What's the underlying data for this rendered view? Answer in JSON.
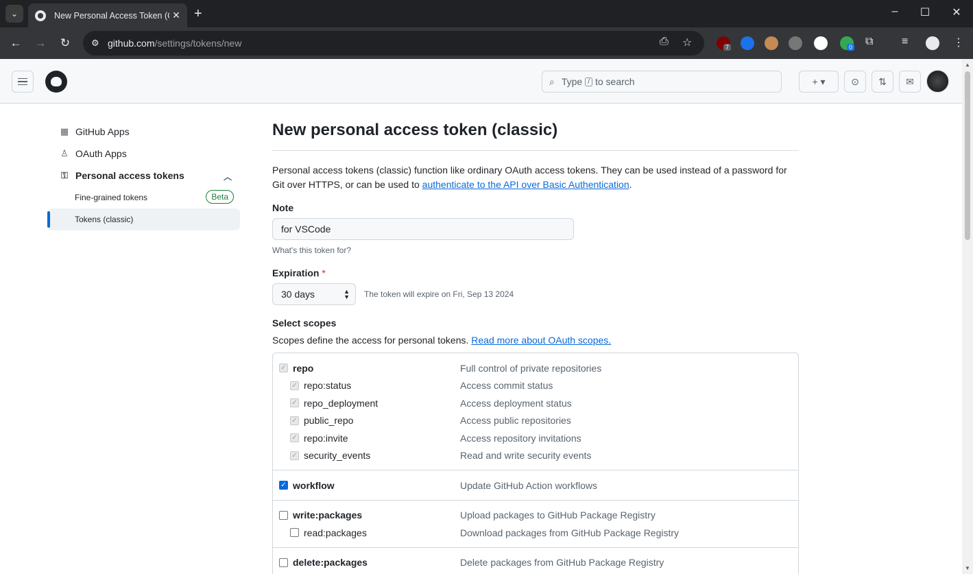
{
  "browser": {
    "tab_title": "New Personal Access Token (Cla",
    "tab_close": "✕",
    "new_tab": "+",
    "url_host": "github.com",
    "url_path": "/settings/tokens/new",
    "window_controls": [
      "–",
      "☐",
      "✕"
    ],
    "extensions": [
      {
        "name": "ublock-icon",
        "color": "#800000",
        "badge": "7"
      },
      {
        "name": "1password-icon",
        "color": "#1a73e8",
        "badge": ""
      },
      {
        "name": "owl-icon",
        "color": "#c58a55",
        "badge": ""
      },
      {
        "name": "tiger-icon",
        "color": "#777777",
        "badge": ""
      },
      {
        "name": "circle-icon",
        "color": "#ffffff",
        "badge": ""
      },
      {
        "name": "colorful-ext-icon",
        "color": "#34a853",
        "badge": "0"
      }
    ]
  },
  "header": {
    "search_prefix": "Type",
    "search_key": "/",
    "search_suffix": "to search",
    "new_button": "+ ▾"
  },
  "sidebar": {
    "items": [
      {
        "label": "GitHub Apps",
        "icon": "apps-icon"
      },
      {
        "label": "OAuth Apps",
        "icon": "person-icon"
      },
      {
        "label": "Personal access tokens",
        "icon": "key-icon"
      }
    ],
    "sub_items": [
      {
        "label": "Fine-grained tokens",
        "badge": "Beta"
      },
      {
        "label": "Tokens (classic)"
      }
    ]
  },
  "main": {
    "title": "New personal access token (classic)",
    "intro_text": "Personal access tokens (classic) function like ordinary OAuth access tokens. They can be used instead of a password for Git over HTTPS, or can be used to ",
    "intro_link": "authenticate to the API over Basic Authentication",
    "intro_end": ".",
    "note_label": "Note",
    "note_value": "for VSCode",
    "note_hint": "What's this token for?",
    "expiration_label": "Expiration",
    "expiration_required": "*",
    "expiration_value": "30 days",
    "expiration_note": "The token will expire on Fri, Sep 13 2024",
    "scopes_label": "Select scopes",
    "scopes_desc": "Scopes define the access for personal tokens. ",
    "scopes_link": "Read more about OAuth scopes."
  },
  "scopes": [
    {
      "rows": [
        {
          "name": "repo",
          "desc": "Full control of private repositories",
          "state": "disabled-checked",
          "sub": false
        },
        {
          "name": "repo:status",
          "desc": "Access commit status",
          "state": "disabled-checked",
          "sub": true
        },
        {
          "name": "repo_deployment",
          "desc": "Access deployment status",
          "state": "disabled-checked",
          "sub": true
        },
        {
          "name": "public_repo",
          "desc": "Access public repositories",
          "state": "disabled-checked",
          "sub": true
        },
        {
          "name": "repo:invite",
          "desc": "Access repository invitations",
          "state": "disabled-checked",
          "sub": true
        },
        {
          "name": "security_events",
          "desc": "Read and write security events",
          "state": "disabled-checked",
          "sub": true
        }
      ]
    },
    {
      "rows": [
        {
          "name": "workflow",
          "desc": "Update GitHub Action workflows",
          "state": "checked",
          "sub": false
        }
      ]
    },
    {
      "rows": [
        {
          "name": "write:packages",
          "desc": "Upload packages to GitHub Package Registry",
          "state": "unchecked",
          "sub": false
        },
        {
          "name": "read:packages",
          "desc": "Download packages from GitHub Package Registry",
          "state": "unchecked",
          "sub": true
        }
      ]
    },
    {
      "rows": [
        {
          "name": "delete:packages",
          "desc": "Delete packages from GitHub Package Registry",
          "state": "unchecked",
          "sub": false
        }
      ]
    }
  ]
}
